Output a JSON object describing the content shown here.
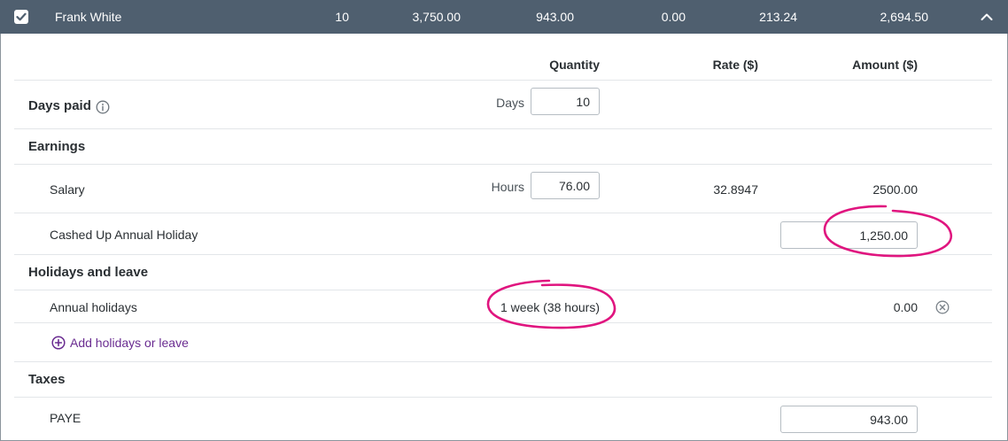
{
  "employee_row": {
    "name": "Frank White",
    "days": "10",
    "gross": "3,750.00",
    "paye": "943.00",
    "deductions": "0.00",
    "super": "213.24",
    "net": "2,694.50"
  },
  "columns": {
    "quantity": "Quantity",
    "rate": "Rate ($)",
    "amount": "Amount ($)"
  },
  "days_paid": {
    "label": "Days paid",
    "unit": "Days",
    "value": "10"
  },
  "earnings": {
    "title": "Earnings",
    "salary": {
      "label": "Salary",
      "unit": "Hours",
      "hours": "76.00",
      "rate": "32.8947",
      "amount": "2500.00"
    },
    "cashed_up": {
      "label": "Cashed Up Annual Holiday",
      "amount": "1,250.00"
    }
  },
  "holidays": {
    "title": "Holidays and leave",
    "annual": {
      "label": "Annual holidays",
      "quantity": "1 week (38 hours)",
      "amount": "0.00"
    },
    "add_link": "Add holidays or leave"
  },
  "taxes": {
    "title": "Taxes",
    "paye": {
      "label": "PAYE",
      "amount": "943.00"
    }
  },
  "colors": {
    "header_bg": "#4f5f6f",
    "link": "#6a2c91",
    "annotation": "#e0157f"
  }
}
